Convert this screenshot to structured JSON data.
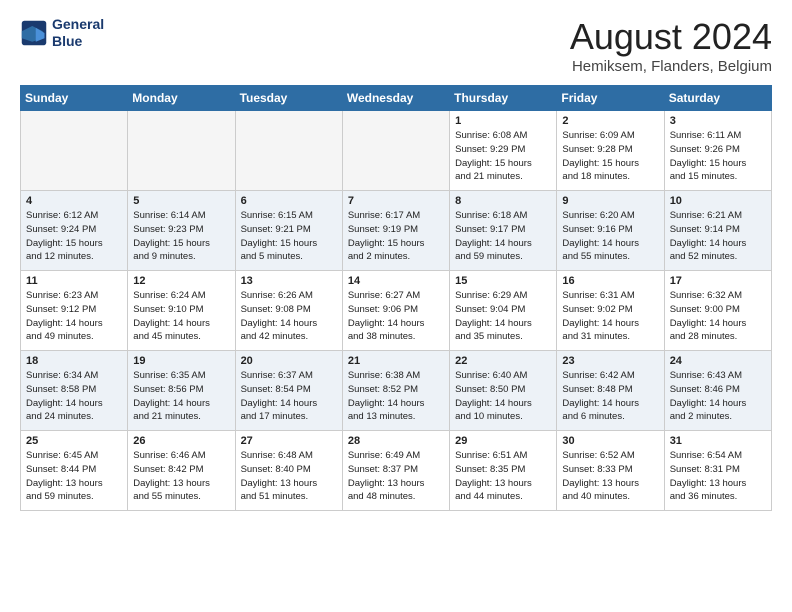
{
  "header": {
    "logo_line1": "General",
    "logo_line2": "Blue",
    "month": "August 2024",
    "location": "Hemiksem, Flanders, Belgium"
  },
  "weekdays": [
    "Sunday",
    "Monday",
    "Tuesday",
    "Wednesday",
    "Thursday",
    "Friday",
    "Saturday"
  ],
  "weeks": [
    [
      {
        "day": "",
        "info": ""
      },
      {
        "day": "",
        "info": ""
      },
      {
        "day": "",
        "info": ""
      },
      {
        "day": "",
        "info": ""
      },
      {
        "day": "1",
        "info": "Sunrise: 6:08 AM\nSunset: 9:29 PM\nDaylight: 15 hours\nand 21 minutes."
      },
      {
        "day": "2",
        "info": "Sunrise: 6:09 AM\nSunset: 9:28 PM\nDaylight: 15 hours\nand 18 minutes."
      },
      {
        "day": "3",
        "info": "Sunrise: 6:11 AM\nSunset: 9:26 PM\nDaylight: 15 hours\nand 15 minutes."
      }
    ],
    [
      {
        "day": "4",
        "info": "Sunrise: 6:12 AM\nSunset: 9:24 PM\nDaylight: 15 hours\nand 12 minutes."
      },
      {
        "day": "5",
        "info": "Sunrise: 6:14 AM\nSunset: 9:23 PM\nDaylight: 15 hours\nand 9 minutes."
      },
      {
        "day": "6",
        "info": "Sunrise: 6:15 AM\nSunset: 9:21 PM\nDaylight: 15 hours\nand 5 minutes."
      },
      {
        "day": "7",
        "info": "Sunrise: 6:17 AM\nSunset: 9:19 PM\nDaylight: 15 hours\nand 2 minutes."
      },
      {
        "day": "8",
        "info": "Sunrise: 6:18 AM\nSunset: 9:17 PM\nDaylight: 14 hours\nand 59 minutes."
      },
      {
        "day": "9",
        "info": "Sunrise: 6:20 AM\nSunset: 9:16 PM\nDaylight: 14 hours\nand 55 minutes."
      },
      {
        "day": "10",
        "info": "Sunrise: 6:21 AM\nSunset: 9:14 PM\nDaylight: 14 hours\nand 52 minutes."
      }
    ],
    [
      {
        "day": "11",
        "info": "Sunrise: 6:23 AM\nSunset: 9:12 PM\nDaylight: 14 hours\nand 49 minutes."
      },
      {
        "day": "12",
        "info": "Sunrise: 6:24 AM\nSunset: 9:10 PM\nDaylight: 14 hours\nand 45 minutes."
      },
      {
        "day": "13",
        "info": "Sunrise: 6:26 AM\nSunset: 9:08 PM\nDaylight: 14 hours\nand 42 minutes."
      },
      {
        "day": "14",
        "info": "Sunrise: 6:27 AM\nSunset: 9:06 PM\nDaylight: 14 hours\nand 38 minutes."
      },
      {
        "day": "15",
        "info": "Sunrise: 6:29 AM\nSunset: 9:04 PM\nDaylight: 14 hours\nand 35 minutes."
      },
      {
        "day": "16",
        "info": "Sunrise: 6:31 AM\nSunset: 9:02 PM\nDaylight: 14 hours\nand 31 minutes."
      },
      {
        "day": "17",
        "info": "Sunrise: 6:32 AM\nSunset: 9:00 PM\nDaylight: 14 hours\nand 28 minutes."
      }
    ],
    [
      {
        "day": "18",
        "info": "Sunrise: 6:34 AM\nSunset: 8:58 PM\nDaylight: 14 hours\nand 24 minutes."
      },
      {
        "day": "19",
        "info": "Sunrise: 6:35 AM\nSunset: 8:56 PM\nDaylight: 14 hours\nand 21 minutes."
      },
      {
        "day": "20",
        "info": "Sunrise: 6:37 AM\nSunset: 8:54 PM\nDaylight: 14 hours\nand 17 minutes."
      },
      {
        "day": "21",
        "info": "Sunrise: 6:38 AM\nSunset: 8:52 PM\nDaylight: 14 hours\nand 13 minutes."
      },
      {
        "day": "22",
        "info": "Sunrise: 6:40 AM\nSunset: 8:50 PM\nDaylight: 14 hours\nand 10 minutes."
      },
      {
        "day": "23",
        "info": "Sunrise: 6:42 AM\nSunset: 8:48 PM\nDaylight: 14 hours\nand 6 minutes."
      },
      {
        "day": "24",
        "info": "Sunrise: 6:43 AM\nSunset: 8:46 PM\nDaylight: 14 hours\nand 2 minutes."
      }
    ],
    [
      {
        "day": "25",
        "info": "Sunrise: 6:45 AM\nSunset: 8:44 PM\nDaylight: 13 hours\nand 59 minutes."
      },
      {
        "day": "26",
        "info": "Sunrise: 6:46 AM\nSunset: 8:42 PM\nDaylight: 13 hours\nand 55 minutes."
      },
      {
        "day": "27",
        "info": "Sunrise: 6:48 AM\nSunset: 8:40 PM\nDaylight: 13 hours\nand 51 minutes."
      },
      {
        "day": "28",
        "info": "Sunrise: 6:49 AM\nSunset: 8:37 PM\nDaylight: 13 hours\nand 48 minutes."
      },
      {
        "day": "29",
        "info": "Sunrise: 6:51 AM\nSunset: 8:35 PM\nDaylight: 13 hours\nand 44 minutes."
      },
      {
        "day": "30",
        "info": "Sunrise: 6:52 AM\nSunset: 8:33 PM\nDaylight: 13 hours\nand 40 minutes."
      },
      {
        "day": "31",
        "info": "Sunrise: 6:54 AM\nSunset: 8:31 PM\nDaylight: 13 hours\nand 36 minutes."
      }
    ]
  ]
}
